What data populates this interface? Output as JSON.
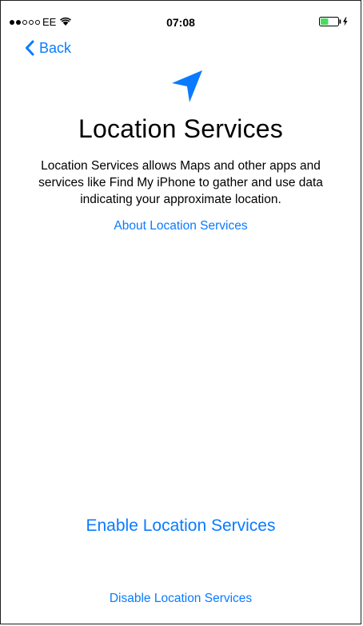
{
  "status_bar": {
    "carrier": "EE",
    "time": "07:08",
    "signal_bars_filled": 2,
    "signal_bars_total": 5,
    "battery_level": 0.45
  },
  "nav": {
    "back_label": "Back"
  },
  "main": {
    "icon": "location-arrow-icon",
    "title": "Location Services",
    "description": "Location Services allows Maps and other apps and services like Find My iPhone to gather and use data indicating your approximate location.",
    "about_link": "About Location Services"
  },
  "actions": {
    "enable_label": "Enable Location Services",
    "disable_label": "Disable Location Services"
  },
  "colors": {
    "accent": "#0a7bff",
    "battery_fill": "#4cd964"
  }
}
